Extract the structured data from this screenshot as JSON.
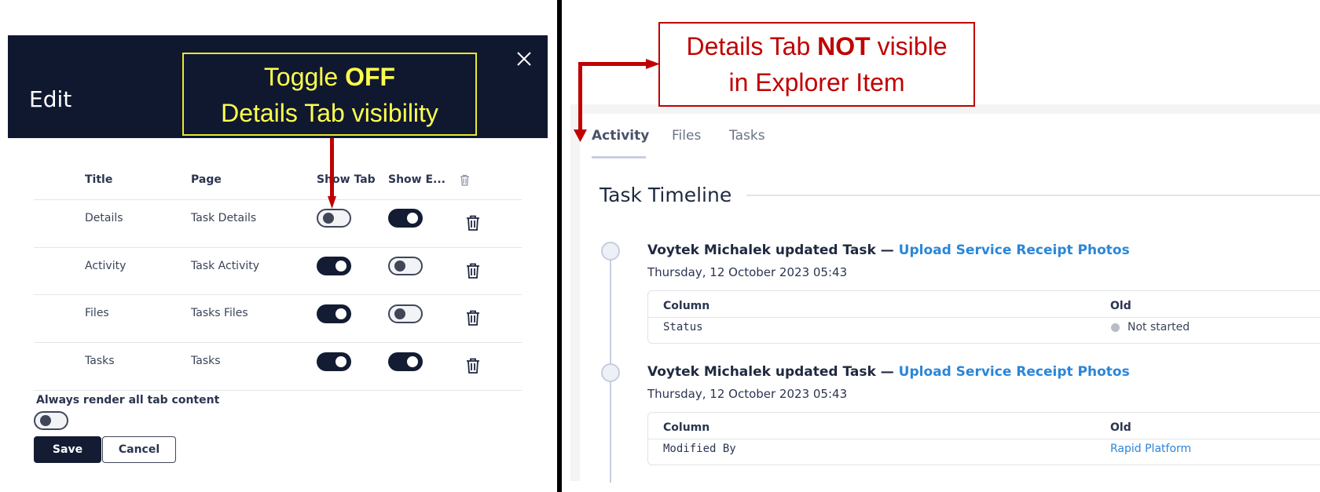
{
  "left_panel": {
    "dialog_title": "Edit",
    "close_icon": "close-icon",
    "callout": {
      "line1_prefix": "Toggle ",
      "line1_bold": "OFF",
      "line2": "Details Tab visibility",
      "color": "#ffff4d"
    },
    "table": {
      "headers": {
        "title": "Title",
        "page": "Page",
        "show_tab": "Show Tab",
        "show_e": "Show E...",
        "delete_icon": "trash-icon"
      },
      "rows": [
        {
          "title": "Details",
          "page": "Task Details",
          "show_tab": false,
          "show_e": true
        },
        {
          "title": "Activity",
          "page": "Task Activity",
          "show_tab": true,
          "show_e": false
        },
        {
          "title": "Files",
          "page": "Tasks Files",
          "show_tab": true,
          "show_e": false
        },
        {
          "title": "Tasks",
          "page": "Tasks",
          "show_tab": true,
          "show_e": true
        }
      ]
    },
    "always_render_label": "Always render all tab content",
    "always_render_value": false,
    "save_label": "Save",
    "cancel_label": "Cancel"
  },
  "right_panel": {
    "callout": {
      "line1_prefix": "Details Tab ",
      "line1_bold": "NOT",
      "line1_suffix": " visible",
      "line2": "in Explorer Item",
      "color": "#c00000"
    },
    "tabs": [
      {
        "label": "Activity",
        "active": true
      },
      {
        "label": "Files",
        "active": false
      },
      {
        "label": "Tasks",
        "active": false
      }
    ],
    "timeline_title": "Task Timeline",
    "entries": [
      {
        "actor_text": "Voytek Michalek updated Task — ",
        "task_link": "Upload Service Receipt Photos",
        "date": "Thursday, 12 October 2023 05:43",
        "col_header": "Column",
        "old_header": "Old",
        "column": "Status",
        "old_value": "Not started"
      },
      {
        "actor_text": "Voytek Michalek updated Task — ",
        "task_link": "Upload Service Receipt Photos",
        "date": "Thursday, 12 October 2023 05:43",
        "col_header": "Column",
        "old_header": "Old",
        "column": "Modified By",
        "old_value": "Rapid Platform"
      }
    ]
  }
}
